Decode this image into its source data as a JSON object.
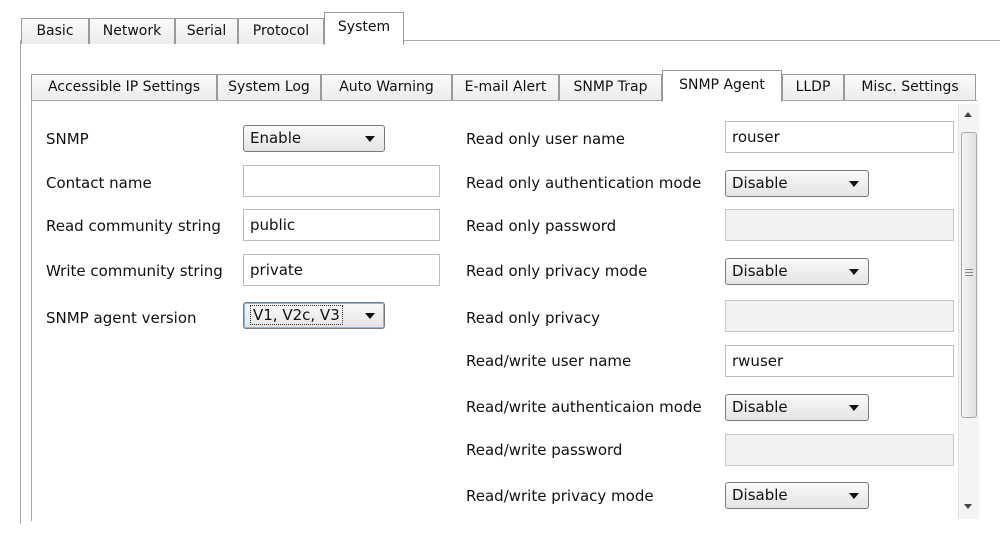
{
  "top_tabs": [
    "Basic",
    "Network",
    "Serial",
    "Protocol",
    "System"
  ],
  "inner_tabs": [
    "Accessible IP Settings",
    "System Log",
    "Auto Warning",
    "E-mail Alert",
    "SNMP Trap",
    "SNMP Agent",
    "LLDP",
    "Misc. Settings"
  ],
  "left": {
    "snmp_label": "SNMP",
    "snmp_value": "Enable",
    "contact_label": "Contact name",
    "contact_value": "",
    "read_comm_label": "Read community string",
    "read_comm_value": "public",
    "write_comm_label": "Write community string",
    "write_comm_value": "private",
    "version_label": "SNMP agent version",
    "version_value": "V1, V2c, V3"
  },
  "right": {
    "ro_user_label": "Read only user name",
    "ro_user_value": "rouser",
    "ro_auth_label": "Read only authentication mode",
    "ro_auth_value": "Disable",
    "ro_pass_label": "Read only password",
    "ro_priv_mode_label": "Read only privacy mode",
    "ro_priv_mode_value": "Disable",
    "ro_priv_label": "Read only privacy",
    "rw_user_label": "Read/write user name",
    "rw_user_value": "rwuser",
    "rw_auth_label": "Read/write authenticaion mode",
    "rw_auth_value": "Disable",
    "rw_pass_label": "Read/write password",
    "rw_priv_mode_label": "Read/write privacy mode",
    "rw_priv_mode_value": "Disable"
  },
  "icons": {
    "scroll_up": "scroll-up-arrow-icon",
    "scroll_down": "scroll-down-arrow-icon",
    "dropdown": "chevron-down-icon"
  },
  "colors": {
    "border": "#a8a8a8",
    "tab_bg": "#ececec",
    "disabled_field": "#f2f2f2"
  }
}
